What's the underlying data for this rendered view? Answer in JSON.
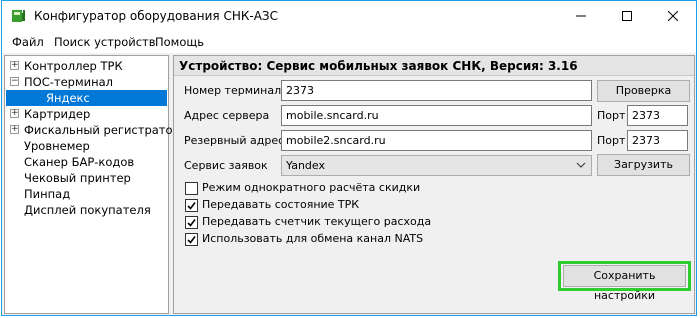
{
  "window": {
    "title": "Конфигуратор оборудования СНК-АЗС"
  },
  "menu": [
    "Файл",
    "Поиск устройств",
    "Помощь"
  ],
  "tree": {
    "items": [
      {
        "label": "Контроллер ТРК",
        "expander": "+"
      },
      {
        "label": "ПОС-терминал",
        "expander": "−"
      },
      {
        "label": "Яндекс"
      },
      {
        "label": "Картридер",
        "expander": "+"
      },
      {
        "label": "Фискальный регистратор",
        "expander": "+"
      },
      {
        "label": "Уровнемер"
      },
      {
        "label": "Сканер БАР-кодов"
      },
      {
        "label": "Чековый принтер"
      },
      {
        "label": "Пинпад"
      },
      {
        "label": "Дисплей покупателя"
      }
    ]
  },
  "panel": {
    "header": "Устройство: Сервис мобильных заявок СНК, Версия: 3.16",
    "terminal_label": "Номер терминала",
    "terminal_value": "2373",
    "check_button": "Проверка связи",
    "server_label": "Адрес сервера",
    "server_value": "mobile.sncard.ru",
    "port_label": "Порт",
    "server_port": "2373",
    "backup_label": "Резервный адрес",
    "backup_value": "mobile2.sncard.ru",
    "backup_port_label": "Порт",
    "backup_port": "2373",
    "service_label": "Сервис заявок",
    "service_value": "Yandex",
    "load_button": "Загрузить",
    "checkboxes": [
      {
        "label": "Режим однократного расчёта скидки",
        "checked": false
      },
      {
        "label": "Передавать состояние ТРК",
        "checked": true
      },
      {
        "label": "Передавать счетчик текущего расхода",
        "checked": true
      },
      {
        "label": "Использовать для обмена канал NATS",
        "checked": true
      }
    ],
    "save_button": "Сохранить настройки"
  },
  "colors": {
    "accent": "#0078d7",
    "highlight": "#2ecc2e",
    "window_border": "#1ba1e2"
  }
}
